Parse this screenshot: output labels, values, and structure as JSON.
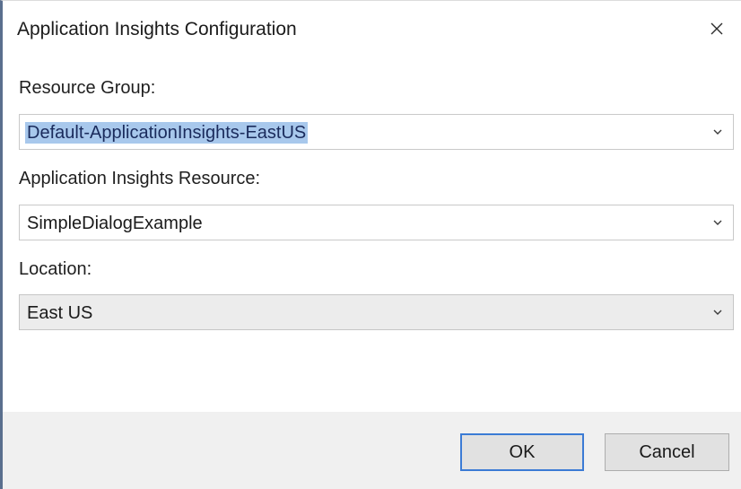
{
  "window": {
    "title": "Application Insights Configuration"
  },
  "fields": {
    "resource_group": {
      "label": "Resource Group:",
      "value": "Default-ApplicationInsights-EastUS"
    },
    "ai_resource": {
      "label": "Application Insights Resource:",
      "value": "SimpleDialogExample"
    },
    "location": {
      "label": "Location:",
      "value": "East US"
    }
  },
  "buttons": {
    "ok": "OK",
    "cancel": "Cancel"
  },
  "icons": {
    "close": "close-icon",
    "dropdown": "chevron-down-icon"
  },
  "colors": {
    "accent": "#3b7bd5",
    "selection": "#a8c8ec",
    "footer": "#f0f0f0"
  }
}
